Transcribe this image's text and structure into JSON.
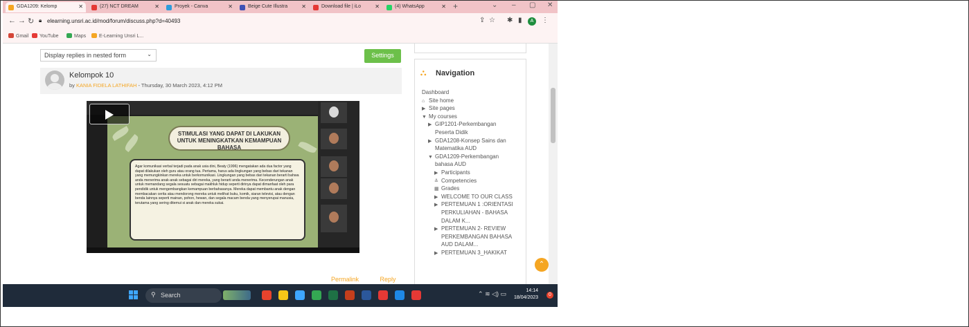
{
  "browser": {
    "tabs": [
      {
        "label": "GDA1209: Kelomp",
        "icon_color": "#f5a623",
        "active": true
      },
      {
        "label": "(27) NCT DREAM",
        "icon_color": "#e53935",
        "active": false
      },
      {
        "label": "Proyek - Canva",
        "icon_color": "#2d9cdb",
        "active": false
      },
      {
        "label": "Beige Cute Illustra",
        "icon_color": "#3f51b5",
        "active": false
      },
      {
        "label": "Download file | iLo",
        "icon_color": "#e53935",
        "active": false
      },
      {
        "label": "(4) WhatsApp",
        "icon_color": "#25d366",
        "active": false
      }
    ],
    "new_tab": "+",
    "url": "elearning.unsri.ac.id/mod/forum/discuss.php?d=40493",
    "bookmarks": [
      {
        "label": "Gmail",
        "icon_color": "#d44638"
      },
      {
        "label": "YouTube",
        "icon_color": "#e53935"
      },
      {
        "label": "Maps",
        "icon_color": "#34a853"
      },
      {
        "label": "E-Learning Unsri L...",
        "icon_color": "#f5a623"
      }
    ],
    "profile_initial": "A"
  },
  "forum": {
    "display_mode": "Display replies in nested form",
    "settings_label": "Settings",
    "post": {
      "subject": "Kelompok 10",
      "by_prefix": "by",
      "author": "KANIA FIDELA LATHIFAH",
      "date": " - Thursday, 30 March 2023, 4:12 PM"
    },
    "slide": {
      "title": "STIMULASI YANG DAPAT DI LAKUKAN UNTUK MENINGKATKAN KEMAMPUAN BAHASA",
      "body": "Agar komunikasi verbal terjadi pada anak usia dini, Beaty (1996) mengatakan ada dua factor yang dapat dilakukan oleh guru atau orang tua. Pertama, harus ada lingkungan yang bebas dari tekanan yang memungkinkan mereka untuk berkomunikasi. Lingkungan yang bebas dari tekanan berarti bahwa anda menerima anak-anak sebagai diri mereka, yang berarti anda menerima. Kecenderungan anak untuk memandang segala sesuatu sebagai makhluk hidup seperti dirinya dapat dimanfaat oleh para pendidik untuk mengembangkan kemampuan berbahasanya. Mereka dapat membantu anak dengan membacakan cerita atau mendorong mereka untuk melihat buku, komik, siaran televisi, atau dengan benda lainnya seperti mainan, pohon, hewan, dan segala macam benda yang menyerupai manusia, terutama yang sering ditemui si anak dan mereka sukai."
    },
    "actions": {
      "permalink": "Permalink",
      "reply": "Reply"
    }
  },
  "navigation": {
    "title": "Navigation",
    "items": [
      {
        "label": "Dashboard",
        "glyph": ""
      },
      {
        "label": "Site home",
        "glyph": "⌂"
      },
      {
        "label": "Site pages",
        "glyph": "▶"
      },
      {
        "label": "My courses",
        "glyph": "▼"
      },
      {
        "label": "GIP1201-Perkembangan",
        "glyph": "▶"
      },
      {
        "label": "Peserta Didik",
        "glyph": ""
      },
      {
        "label": "GDA1208-Konsep Sains dan",
        "glyph": "▶"
      },
      {
        "label": "Matematika AUD",
        "glyph": ""
      },
      {
        "label": "GDA1209-Perkembangan",
        "glyph": "▼"
      },
      {
        "label": "bahasa AUD",
        "glyph": ""
      },
      {
        "label": "Participants",
        "glyph": "▶"
      },
      {
        "label": "Competencies",
        "glyph": "≙"
      },
      {
        "label": "Grades",
        "glyph": "▦"
      },
      {
        "label": "WELCOME TO OUR CLASS",
        "glyph": "▶"
      },
      {
        "label": "PERTEMUAN 1 :ORIENTASI",
        "glyph": "▶"
      },
      {
        "label": "PERKULIAHAN - BAHASA",
        "glyph": ""
      },
      {
        "label": "DALAM K...",
        "glyph": ""
      },
      {
        "label": "PERTEMUAN 2- REVIEW",
        "glyph": "▶"
      },
      {
        "label": "PERKEMBANGAN BAHASA",
        "glyph": ""
      },
      {
        "label": "AUD DALAM...",
        "glyph": ""
      },
      {
        "label": "PERTEMUAN 3_HAKIKAT",
        "glyph": "▶"
      }
    ]
  },
  "taskbar": {
    "search_label": "Search",
    "time": "14:14",
    "date": "18/04/2023",
    "notification_count": "0",
    "app_colors": [
      "#3ea6ff",
      "#e8432d",
      "#f5c518",
      "#3ea6ff",
      "#34a853",
      "#1e7145",
      "#c43e1c",
      "#2b579a",
      "#e53935",
      "#1e88e5",
      "#e53935"
    ]
  }
}
